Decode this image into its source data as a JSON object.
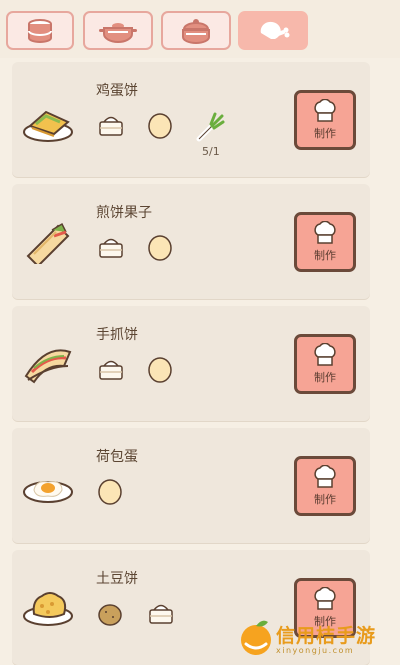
{
  "tabs": [
    {
      "icon": "rice-bag-icon",
      "active": false
    },
    {
      "icon": "pot-icon",
      "active": false
    },
    {
      "icon": "casserole-icon",
      "active": false
    },
    {
      "icon": "drumstick-icon",
      "active": true
    }
  ],
  "recipes": [
    {
      "name": "鸡蛋饼",
      "dish_icon": "egg-pancake-icon",
      "ingredients": [
        {
          "icon": "flour-bowl-icon"
        },
        {
          "icon": "egg-icon"
        },
        {
          "icon": "scallion-icon",
          "count": "5/1"
        }
      ],
      "button_label": "制作"
    },
    {
      "name": "煎饼果子",
      "dish_icon": "jianbing-wrap-icon",
      "ingredients": [
        {
          "icon": "flour-bowl-icon"
        },
        {
          "icon": "egg-icon"
        }
      ],
      "button_label": "制作"
    },
    {
      "name": "手抓饼",
      "dish_icon": "hand-pancake-icon",
      "ingredients": [
        {
          "icon": "flour-bowl-icon"
        },
        {
          "icon": "egg-icon"
        }
      ],
      "button_label": "制作"
    },
    {
      "name": "荷包蛋",
      "dish_icon": "fried-egg-icon",
      "ingredients": [
        {
          "icon": "egg-icon"
        }
      ],
      "button_label": "制作"
    },
    {
      "name": "土豆饼",
      "dish_icon": "potato-pancake-icon",
      "ingredients": [
        {
          "icon": "potato-icon"
        },
        {
          "icon": "flour-bowl-icon"
        }
      ],
      "button_label": "制作"
    }
  ],
  "watermark": {
    "title": "信用桔手游",
    "subtitle": "xinyongju.com"
  }
}
